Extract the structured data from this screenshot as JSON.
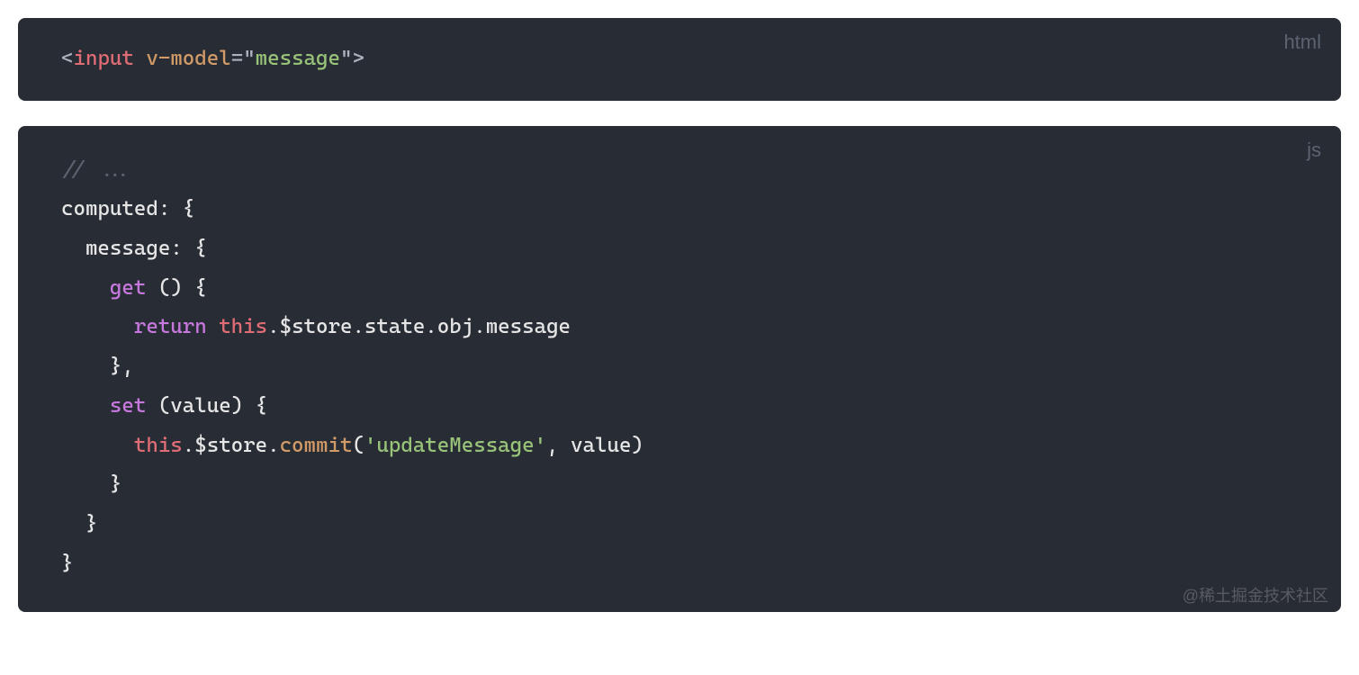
{
  "block1": {
    "lang": "html",
    "t_open": "<",
    "t_tag": "input",
    "t_sp1": " ",
    "t_attr": "v-model",
    "t_eq": "=",
    "t_q1": "\"",
    "t_val": "message",
    "t_q2": "\"",
    "t_close": ">"
  },
  "block2": {
    "lang": "js",
    "l1_comment": "// ...",
    "l2_computed": "computed: {",
    "l3_ind": "  ",
    "l3_msg": "message: {",
    "l4_ind": "    ",
    "l4_get": "get",
    "l4_rest": " () {",
    "l5_ind": "      ",
    "l5_return": "return",
    "l5_sp": " ",
    "l5_this": "this",
    "l5_rest": ".$store.state.obj.message",
    "l6": "    },",
    "l7_ind": "    ",
    "l7_set": "set",
    "l7_rest": " (value) {",
    "l8_ind": "      ",
    "l8_this": "this",
    "l8_mid": ".$store.",
    "l8_commit": "commit",
    "l8_open": "(",
    "l8_str": "'updateMessage'",
    "l8_rest": ", value)",
    "l9": "    }",
    "l10": "  }",
    "l11": "}"
  },
  "watermark": "@稀土掘金技术社区"
}
